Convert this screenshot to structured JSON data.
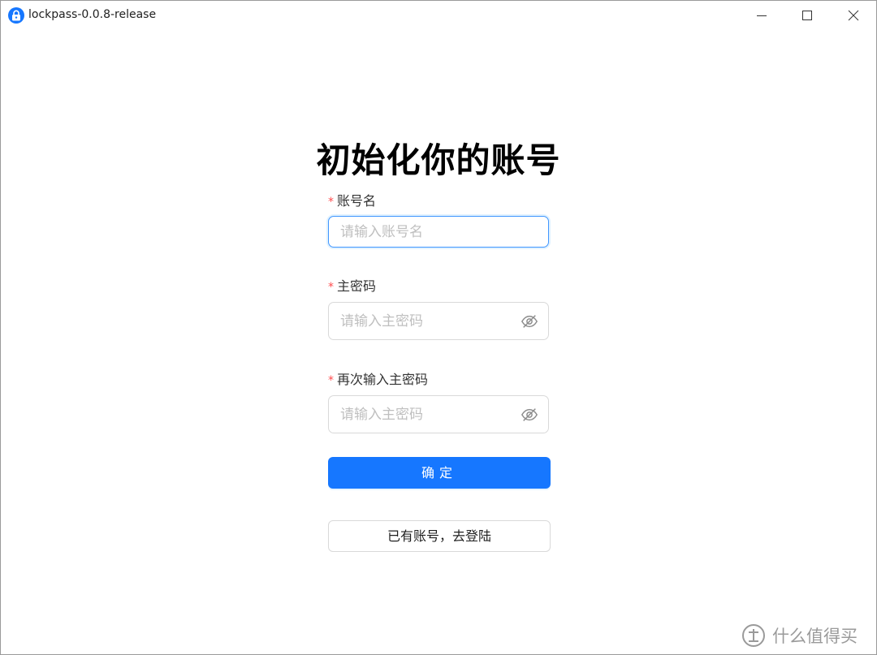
{
  "window": {
    "title": "lockpass-0.0.8-release",
    "icon": "lock-icon",
    "controls": [
      "minimize-icon",
      "maximize-icon",
      "close-icon"
    ]
  },
  "form": {
    "heading": "初始化你的账号",
    "required_mark": "*",
    "account": {
      "label": "账号名",
      "placeholder": "请输入账号名",
      "value": ""
    },
    "password": {
      "label": "主密码",
      "placeholder": "请输入主密码",
      "value": "",
      "toggle_icon": "eye-hidden-icon"
    },
    "confirm_password": {
      "label": "再次输入主密码",
      "placeholder": "请输入主密码",
      "value": "",
      "toggle_icon": "eye-hidden-icon"
    },
    "submit_label": "确定",
    "login_link_label": "已有账号，去登陆"
  },
  "watermark": {
    "text": "什么值得买",
    "icon": "zhi-logo-icon"
  },
  "colors": {
    "primary": "#1677ff",
    "required": "#ff4d4f",
    "border": "#d9d9d9",
    "focus_border": "#4096ff"
  }
}
